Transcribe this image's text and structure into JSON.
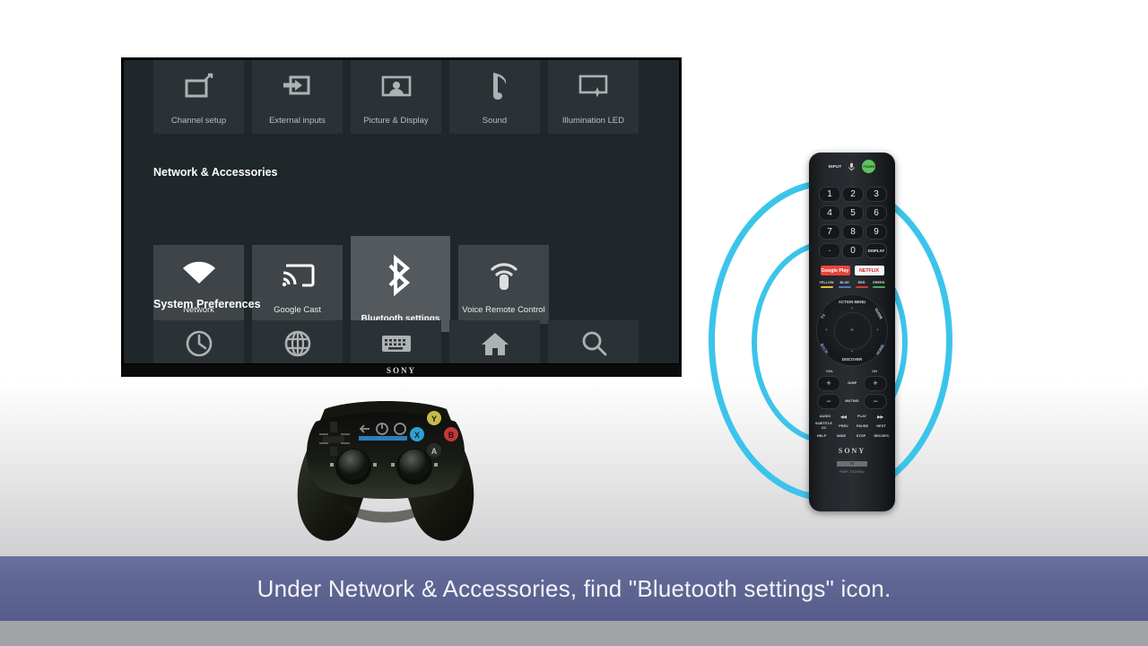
{
  "caption": {
    "text": "Under Network & Accessories, find \"Bluetooth settings\" icon."
  },
  "tv": {
    "brand": "SONY",
    "sections": [
      {
        "title": "",
        "tiles": [
          {
            "label": "Channel setup",
            "icon": "channel-setup-icon"
          },
          {
            "label": "External inputs",
            "icon": "external-inputs-icon"
          },
          {
            "label": "Picture & Display",
            "icon": "picture-display-icon"
          },
          {
            "label": "Sound",
            "icon": "sound-note-icon"
          },
          {
            "label": "Illumination LED",
            "icon": "illumination-led-icon"
          }
        ]
      },
      {
        "title": "Network & Accessories",
        "tiles": [
          {
            "label": "Network",
            "icon": "wifi-icon",
            "selected": false
          },
          {
            "label": "Google Cast",
            "icon": "cast-icon",
            "selected": false
          },
          {
            "label": "Bluetooth settings",
            "icon": "bluetooth-icon",
            "selected": true
          },
          {
            "label": "Voice Remote Control",
            "icon": "voice-remote-icon",
            "selected": false
          }
        ]
      },
      {
        "title": "System Preferences",
        "tiles": [
          {
            "label": "",
            "icon": "clock-icon"
          },
          {
            "label": "",
            "icon": "globe-icon"
          },
          {
            "label": "",
            "icon": "keyboard-icon"
          },
          {
            "label": "",
            "icon": "home-icon"
          },
          {
            "label": "",
            "icon": "search-icon"
          }
        ]
      }
    ]
  },
  "remote": {
    "brand": "SONY",
    "model": "RMF-TX200U",
    "tv_tag": "TV",
    "top_buttons": [
      "INPUT",
      "POWER"
    ],
    "mic_icon": "microphone-icon",
    "keypad": [
      "1",
      "2",
      "3",
      "4",
      "5",
      "6",
      "7",
      "8",
      "9",
      "·",
      "0",
      "DISPLAY"
    ],
    "app_buttons": [
      {
        "label": "Google Play",
        "color": "#e8453c"
      },
      {
        "label": "NETFLIX",
        "color": "#f5f5f5"
      }
    ],
    "color_buttons": [
      {
        "label": "YELLOW",
        "color": "#d8c23a"
      },
      {
        "label": "BLUE",
        "color": "#5476c8"
      },
      {
        "label": "RED",
        "color": "#d03a3a"
      },
      {
        "label": "GREEN",
        "color": "#3fae5a"
      }
    ],
    "dpad_labels": {
      "top": "ACTION MENU",
      "left": "TV",
      "right": "GUIDE",
      "bottom_left": "BACK",
      "bottom_right": "HOME",
      "bottom": "DISCOVER"
    },
    "vol_label": "VOL",
    "ch_label": "CH",
    "jump_label": "JUMP",
    "muting_label": "MUTING",
    "media_rows": [
      [
        "AUDIO",
        "◀◀",
        "PLAY",
        "▶▶"
      ],
      [
        "SUBTITLE CC",
        "PREV",
        "PAUSE",
        "NEXT"
      ],
      [
        "HELP",
        "WIDE",
        "STOP",
        "REC/SFC"
      ]
    ]
  },
  "colors": {
    "ring": "#3bc4ea",
    "caption_bar": "#5f6693",
    "selected_tile": "#53595d",
    "tile": "#3e4448",
    "screen_bg": "#20272b"
  },
  "controller": {
    "name": "game-controller",
    "buttons": [
      {
        "label": "Y",
        "color": "#d7c84a"
      },
      {
        "label": "X",
        "color": "#3aa7d8"
      },
      {
        "label": "B",
        "color": "#c94040"
      },
      {
        "label": "A",
        "color": "#7fc44a"
      }
    ]
  }
}
